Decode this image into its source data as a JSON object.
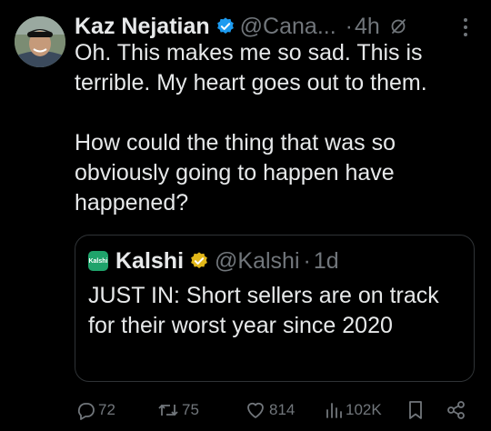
{
  "tweet": {
    "author_name": "Kaz Nejatian",
    "handle": "@Cana...",
    "separator": "·",
    "time": "4h",
    "paragraphs": [
      "Oh. This makes me so sad. This is terrible.  My heart goes out to them.",
      "How could the thing that was so obviously going to happen have happened?"
    ]
  },
  "quote": {
    "logo_text": "Kalshi",
    "author_name": "Kalshi",
    "handle": "@Kalshi",
    "separator": "·",
    "time": "1d",
    "text": "JUST IN: Short sellers are on track for their worst year since 2020"
  },
  "actions": {
    "replies": "72",
    "reposts": "75",
    "likes": "814",
    "views": "102K"
  },
  "colors": {
    "background": "#000000",
    "text": "#e7e9ea",
    "muted": "#71767b",
    "verified_blue": "#1d9bf0",
    "verified_gold": "#e2b719",
    "kalshi_green": "#1fa36b",
    "border": "#2f3336"
  },
  "icons": [
    "avatar",
    "verified-badge-icon",
    "grok-icon",
    "more-icon",
    "kalshi-logo",
    "gold-verified-badge-icon",
    "reply-icon",
    "repost-icon",
    "like-icon",
    "views-icon",
    "bookmark-icon",
    "share-icon"
  ]
}
